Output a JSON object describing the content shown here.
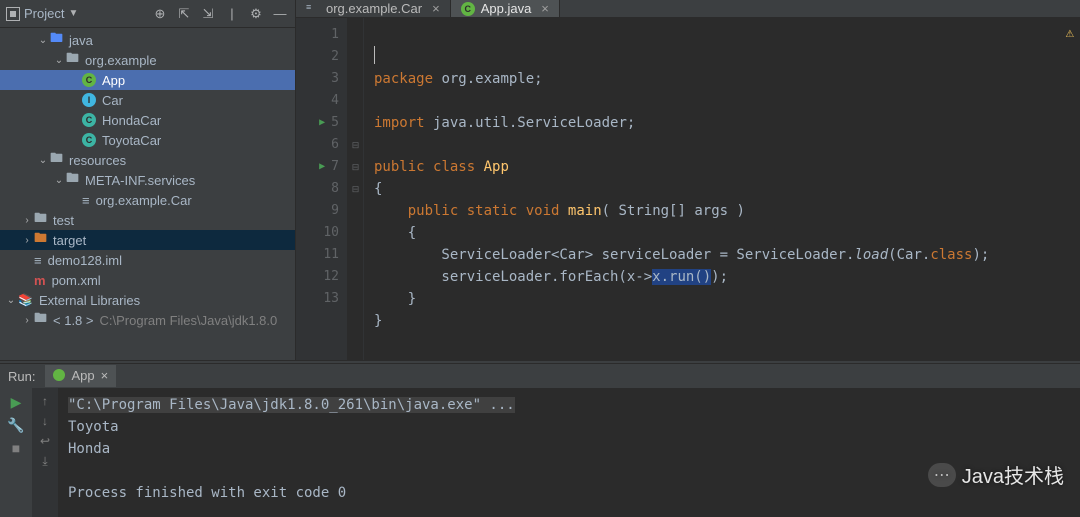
{
  "sidebar": {
    "title": "Project",
    "tree": [
      {
        "depth": 2,
        "arrow": "v",
        "iconType": "folder",
        "iconColor": "blue",
        "label": "java"
      },
      {
        "depth": 3,
        "arrow": "v",
        "iconType": "folder",
        "iconColor": "",
        "label": "org.example"
      },
      {
        "depth": 4,
        "arrow": "",
        "iconType": "circle",
        "circle": "green",
        "glyph": "C",
        "label": "App",
        "current": true
      },
      {
        "depth": 4,
        "arrow": "",
        "iconType": "circle",
        "circle": "blue",
        "glyph": "I",
        "label": "Car"
      },
      {
        "depth": 4,
        "arrow": "",
        "iconType": "circle",
        "circle": "teal",
        "glyph": "C",
        "label": "HondaCar"
      },
      {
        "depth": 4,
        "arrow": "",
        "iconType": "circle",
        "circle": "teal",
        "glyph": "C",
        "label": "ToyotaCar"
      },
      {
        "depth": 2,
        "arrow": "v",
        "iconType": "folder",
        "iconColor": "",
        "label": "resources"
      },
      {
        "depth": 3,
        "arrow": "v",
        "iconType": "folder",
        "iconColor": "",
        "label": "META-INF.services"
      },
      {
        "depth": 4,
        "arrow": "",
        "iconType": "file",
        "label": "org.example.Car"
      },
      {
        "depth": 1,
        "arrow": ">",
        "iconType": "folder",
        "iconColor": "",
        "label": "test"
      },
      {
        "depth": 1,
        "arrow": ">",
        "iconType": "folder",
        "iconColor": "orange",
        "label": "target",
        "selected": true
      },
      {
        "depth": 1,
        "arrow": "",
        "iconType": "file",
        "label": "demo128.iml"
      },
      {
        "depth": 1,
        "arrow": "",
        "iconType": "m",
        "label": "pom.xml"
      },
      {
        "depth": 0,
        "arrow": "v",
        "iconType": "lib",
        "label": "External Libraries"
      },
      {
        "depth": 1,
        "arrow": ">",
        "iconType": "folder",
        "iconColor": "",
        "label": "< 1.8 >",
        "dim": "C:\\Program Files\\Java\\jdk1.8.0"
      }
    ]
  },
  "tabs": [
    {
      "icon": "file",
      "label": "org.example.Car",
      "active": false
    },
    {
      "icon": "class",
      "label": "App.java",
      "active": true
    }
  ],
  "gutter": {
    "lines": [
      "1",
      "2",
      "3",
      "4",
      "5",
      "6",
      "7",
      "8",
      "9",
      "10",
      "11",
      "12",
      "13"
    ],
    "runMarkers": [
      5,
      7
    ]
  },
  "code": {
    "line1": {
      "kw": "package",
      "rest": " org.example;"
    },
    "line3": {
      "kw": "import",
      "rest": " java.util.ServiceLoader;"
    },
    "line5": {
      "kw1": "public",
      "kw2": "class",
      "name": "App"
    },
    "line6": "{",
    "line7": {
      "kw1": "public",
      "kw2": "static",
      "kw3": "void",
      "name": "main",
      "args": "( String[] args )"
    },
    "line8": "    {",
    "line9": {
      "pre": "        ServiceLoader<Car> serviceLoader = ServiceLoader.",
      "it": "load",
      "post1": "(Car.",
      "kw": "class",
      "post2": ");"
    },
    "line10": {
      "pre": "        serviceLoader.forEach(x->",
      "hl": "x.run()",
      "post": ");"
    },
    "line11": "    }",
    "line12": "}"
  },
  "run": {
    "label": "Run:",
    "tab": "App",
    "output": [
      "\"C:\\Program Files\\Java\\jdk1.8.0_261\\bin\\java.exe\" ...",
      "Toyota",
      "Honda",
      "",
      "Process finished with exit code 0"
    ]
  },
  "watermark": "Java技术栈"
}
